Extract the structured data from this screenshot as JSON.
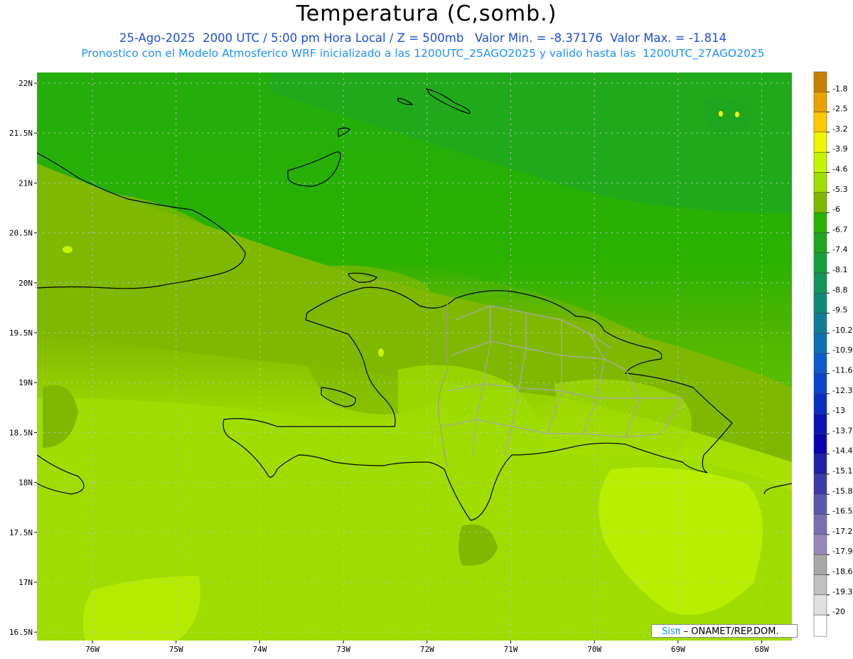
{
  "title": "Temperatura (C,somb.)",
  "subtitle_line1": "25-Ago-2025  2000 UTC / 5:00 pm Hora Local / Z = 500mb   Valor Min. = -8.37176  Valor Max. = -1.814",
  "subtitle_line2": "Pronostico con el Modelo Atmosferico WRF inicializado a las 1200UTC_25AGO2025 y valido hasta las  1200UTC_27AGO2025",
  "credit": {
    "brand": "Sisπ",
    "text": " – ONAMET/REP.DOM."
  },
  "lat_labels": [
    "22N",
    "21.5N",
    "21N",
    "20.5N",
    "20N",
    "19.5N",
    "19N",
    "18.5N",
    "18N",
    "17.5N",
    "17N",
    "16.5N"
  ],
  "lon_labels": [
    "76W",
    "75W",
    "74W",
    "73W",
    "72W",
    "71W",
    "70W",
    "69W",
    "68W"
  ],
  "colorbar": {
    "labels": [
      "-1.8",
      "-2.5",
      "-3.2",
      "-3.9",
      "-4.6",
      "-5.3",
      "-6",
      "-6.7",
      "-7.4",
      "-8.1",
      "-8.8",
      "-9.5",
      "-10.2",
      "-10.9",
      "-11.6",
      "-12.3",
      "-13",
      "-13.7",
      "-14.4",
      "-15.1",
      "-15.8",
      "-16.5",
      "-17.2",
      "-17.9",
      "-18.6",
      "-19.3",
      "-20"
    ],
    "colors": [
      "#c98000",
      "#e8a300",
      "#ffc800",
      "#f2f500",
      "#c3f500",
      "#9fdc00",
      "#7fb800",
      "#29b200",
      "#1ea61e",
      "#14a03c",
      "#12965a",
      "#108a78",
      "#0e7e96",
      "#0a70b4",
      "#0a5ccc",
      "#0a44c8",
      "#0a2ec0",
      "#0a14b8",
      "#0a00b0",
      "#2020a8",
      "#3c3ca8",
      "#5a5aac",
      "#7a70b0",
      "#9888b8",
      "#a8a8a8",
      "#c0c0c0",
      "#e0e0e0"
    ]
  },
  "field_colors": {
    "north": "#1ea61e",
    "north_deep": "#14a03c",
    "mid": "#29b200",
    "transition": "#7fb800",
    "south": "#9fdc00",
    "south_light": "#c3f500",
    "warm_spot": "#f2f500"
  },
  "map_features": [
    "Cuba coast",
    "Bahamas islands",
    "Haiti",
    "Republica Dominicana provinces",
    "Puerto Rico coast"
  ]
}
